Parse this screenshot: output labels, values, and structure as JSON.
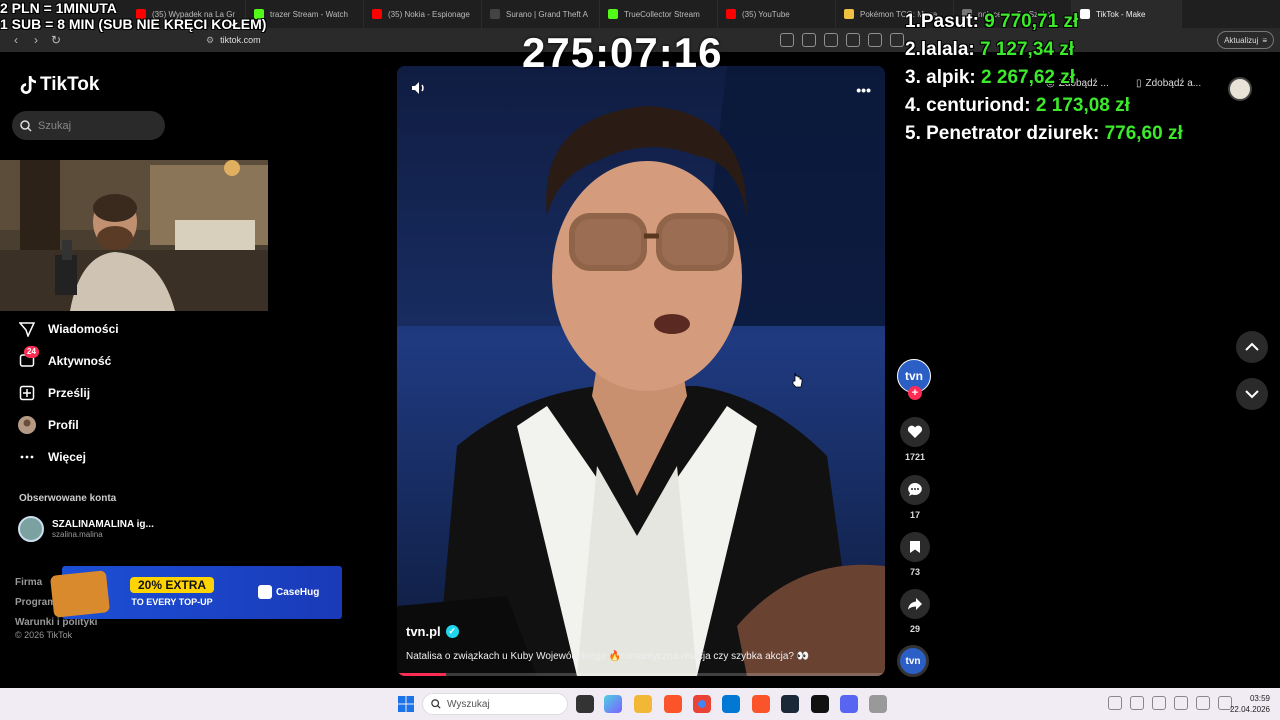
{
  "browser": {
    "tabs": [
      {
        "label": "(35) Wypadek na La Gr",
        "color": "#ff0000"
      },
      {
        "label": "trazer Stream - Watch",
        "color": "#53fc18"
      },
      {
        "label": "(35) Nokia - Espionage",
        "color": "#ff0000"
      },
      {
        "label": "Surano | Grand Theft A",
        "color": "#444444"
      },
      {
        "label": "TrueCollector Stream",
        "color": "#53fc18"
      },
      {
        "label": "(35) YouTube",
        "color": "#ff0000"
      },
      {
        "label": "Pokémon TCG: Mega",
        "color": "#f0c040"
      },
      {
        "label": "nolace gta 5 - Szukaj",
        "color": "#777777"
      },
      {
        "label": "TikTok - Make",
        "color": "#ffffff"
      }
    ],
    "url": "tiktok.com",
    "update_label": "Aktualizuj"
  },
  "overlay": {
    "line1": "2 PLN = 1MINUTA",
    "line2": "1 SUB = 8 MIN (SUB NIE KRĘCI KOŁEM)",
    "timer": "275:07:16",
    "leaderboard": [
      {
        "name": "1.Pasut:",
        "amount": "9 770,71 zł"
      },
      {
        "name": "2.lalala:",
        "amount": "7 127,34 zł"
      },
      {
        "name": "3. alpik:",
        "amount": "2 267,62 zł"
      },
      {
        "name": "4. centuriond:",
        "amount": "2 173,08 zł"
      },
      {
        "name": "5. Penetrator dziurek:",
        "amount": "776,60 zł"
      }
    ]
  },
  "header": {
    "get_app_1": "Zdobądź ...",
    "get_app_2": "Zdobądź a..."
  },
  "sidebar": {
    "logo": "TikTok",
    "search_placeholder": "Szukaj",
    "items": [
      {
        "label": "Wiadomości",
        "icon": "send-icon"
      },
      {
        "label": "Aktywność",
        "icon": "inbox-icon",
        "badge": "24"
      },
      {
        "label": "Prześlij",
        "icon": "upload-icon"
      },
      {
        "label": "Profil",
        "icon": "avatar"
      },
      {
        "label": "Więcej",
        "icon": "more-icon"
      }
    ],
    "followed_title": "Obserwowane konta",
    "followed": {
      "name": "SZALINAMALINA ig...",
      "handle": "szalina.malina"
    },
    "footer": [
      "Firma",
      "Programy",
      "Warunki i polityki"
    ],
    "copyright": "© 2026 TikTok"
  },
  "ad": {
    "headline": "20% EXTRA",
    "sub": "TO EVERY TOP-UP",
    "brand": "CaseHug"
  },
  "video": {
    "author": "tvn.pl",
    "description": "Natalisa o związkach u Kuby Wojewódzkiego 🔥romantyczna relacja czy szybka akcja? 👀",
    "progress": 0.1,
    "creator_avatar": "tvn",
    "likes": "1721",
    "comments": "17",
    "saves": "73",
    "shares": "29"
  },
  "taskbar": {
    "search_placeholder": "Wyszukaj",
    "time": "03:59",
    "date": "22.04.2026"
  }
}
